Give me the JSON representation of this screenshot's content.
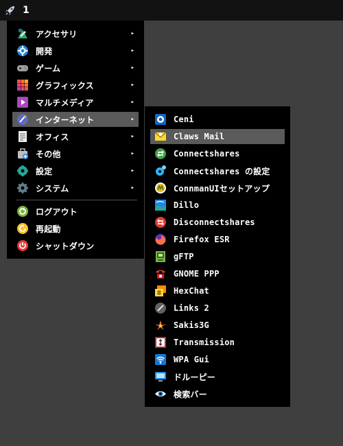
{
  "taskbar": {
    "workspace": "1",
    "launcher_icon": "rocket-icon"
  },
  "main_menu": {
    "items": [
      {
        "label": "アクセサリ",
        "icon": "accessories-icon",
        "has_submenu": true
      },
      {
        "label": "開発",
        "icon": "development-icon",
        "has_submenu": true
      },
      {
        "label": "ゲーム",
        "icon": "gamepad-icon",
        "has_submenu": true
      },
      {
        "label": "グラフィックス",
        "icon": "graphics-icon",
        "has_submenu": true
      },
      {
        "label": "マルチメディア",
        "icon": "multimedia-icon",
        "has_submenu": true
      },
      {
        "label": "インターネット",
        "icon": "internet-icon",
        "has_submenu": true,
        "highlighted": true
      },
      {
        "label": "オフィス",
        "icon": "office-icon",
        "has_submenu": true
      },
      {
        "label": "その他",
        "icon": "other-icon",
        "has_submenu": true
      },
      {
        "label": "設定",
        "icon": "settings-icon",
        "has_submenu": true
      },
      {
        "label": "システム",
        "icon": "system-icon",
        "has_submenu": true
      }
    ],
    "session_items": [
      {
        "label": "ログアウト",
        "icon": "logout-icon"
      },
      {
        "label": "再起動",
        "icon": "reboot-icon"
      },
      {
        "label": "シャットダウン",
        "icon": "shutdown-icon"
      }
    ],
    "submenu_arrow": "▸"
  },
  "internet_submenu": {
    "items": [
      {
        "label": "Ceni",
        "icon": "ceni-icon"
      },
      {
        "label": "Claws Mail",
        "icon": "claws-mail-icon",
        "highlighted": true
      },
      {
        "label": "Connectshares",
        "icon": "connectshares-icon"
      },
      {
        "label": "Connectshares の設定",
        "icon": "connectshares-config-icon"
      },
      {
        "label": "ConnmanUIセットアップ",
        "icon": "connman-icon"
      },
      {
        "label": "Dillo",
        "icon": "dillo-icon"
      },
      {
        "label": "Disconnectshares",
        "icon": "disconnectshares-icon"
      },
      {
        "label": "Firefox ESR",
        "icon": "firefox-icon"
      },
      {
        "label": "gFTP",
        "icon": "gftp-icon"
      },
      {
        "label": "GNOME PPP",
        "icon": "phone-icon"
      },
      {
        "label": "HexChat",
        "icon": "hexchat-icon"
      },
      {
        "label": "Links 2",
        "icon": "links-icon"
      },
      {
        "label": "Sakis3G",
        "icon": "sakis3g-icon"
      },
      {
        "label": "Transmission",
        "icon": "transmission-icon"
      },
      {
        "label": "WPA Gui",
        "icon": "wifi-icon"
      },
      {
        "label": "ドルーピー",
        "icon": "monitor-icon"
      },
      {
        "label": "検索バー",
        "icon": "eye-icon"
      }
    ]
  },
  "colors": {
    "desktop": "#3f3f3f",
    "taskbar": "#121212",
    "menu_bg": "#000000",
    "highlight": "#5a5a5a"
  }
}
